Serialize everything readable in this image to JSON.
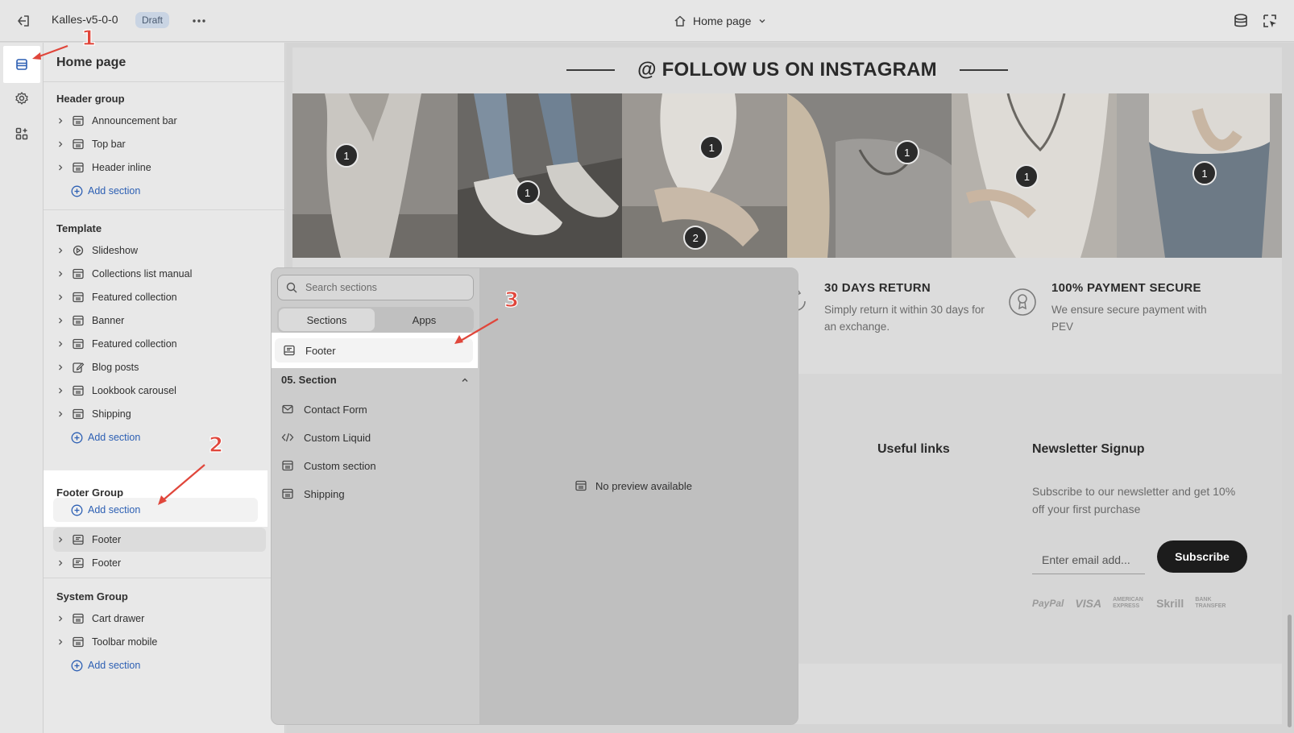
{
  "topbar": {
    "theme_name": "Kalles-v5-0-0",
    "status_badge": "Draft",
    "page_selector": "Home page"
  },
  "sidebar": {
    "title": "Home page",
    "header_group": {
      "label": "Header group",
      "items": [
        "Announcement bar",
        "Top bar",
        "Header inline"
      ],
      "add_label": "Add section"
    },
    "template": {
      "label": "Template",
      "items": [
        "Slideshow",
        "Collections list manual",
        "Featured collection",
        "Banner",
        "Featured collection",
        "Blog posts",
        "Lookbook carousel",
        "Shipping"
      ],
      "add_label": "Add section"
    },
    "footer_group": {
      "label": "Footer Group",
      "add_label": "Add section",
      "items": [
        "Footer",
        "Footer"
      ]
    },
    "system_group": {
      "label": "System Group",
      "items": [
        "Cart drawer",
        "Toolbar mobile"
      ],
      "add_label": "Add section"
    }
  },
  "preview": {
    "instagram_title": "@ FOLLOW US ON INSTAGRAM",
    "photo_pins": [
      [
        "1"
      ],
      [
        "1"
      ],
      [
        "1",
        "2"
      ],
      [
        "1"
      ],
      [
        "1"
      ],
      [
        "1"
      ]
    ],
    "features": [
      {
        "title": "30 DAYS RETURN",
        "desc": "Simply return it within 30 days for an exchange."
      },
      {
        "title": "100% PAYMENT SECURE",
        "desc": "We ensure secure payment with PEV"
      }
    ],
    "useful_links": "Useful links",
    "newsletter": {
      "title": "Newsletter Signup",
      "desc": "Subscribe to our newsletter and get 10% off your first purchase",
      "placeholder": "Enter email add...",
      "button": "Subscribe"
    },
    "payments": [
      "PayPal",
      "VISA",
      "AMERICAN EXPRESS",
      "Skrill",
      "BANK TRANSFER"
    ]
  },
  "popup": {
    "search_placeholder": "Search sections",
    "tabs": [
      "Sections",
      "Apps"
    ],
    "highlighted_item": "Footer",
    "category": "05. Section",
    "items": [
      "Contact Form",
      "Custom Liquid",
      "Custom section",
      "Shipping"
    ],
    "no_preview": "No preview available"
  },
  "callouts": [
    "1",
    "2",
    "3"
  ],
  "colors": {
    "accent_link": "#2c5fb3",
    "callout_red": "#e0463b",
    "subscribe_bg": "#1c1c1c"
  }
}
